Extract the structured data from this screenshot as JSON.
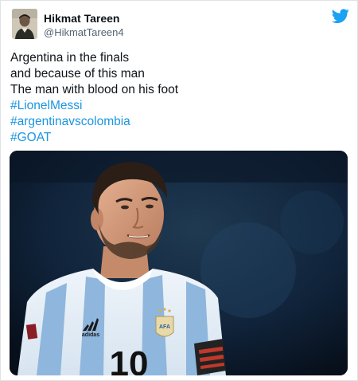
{
  "author": {
    "display_name": "Hikmat Tareen",
    "handle": "@HikmatTareen4",
    "avatar_icon": "profile-avatar"
  },
  "brand": {
    "icon": "twitter-bird-icon",
    "color": "#1da1f2"
  },
  "tweet": {
    "lines": [
      "Argentina in the finals",
      "and because of this man",
      "The man with blood on his foot"
    ],
    "hashtags": [
      "#LionelMessi",
      "#argentinavscolombia",
      "#GOAT"
    ],
    "hashtag_color": "#1b95e0"
  },
  "media": {
    "jersey": {
      "brand": "adidas",
      "badge": "AFA",
      "number": "10"
    }
  }
}
